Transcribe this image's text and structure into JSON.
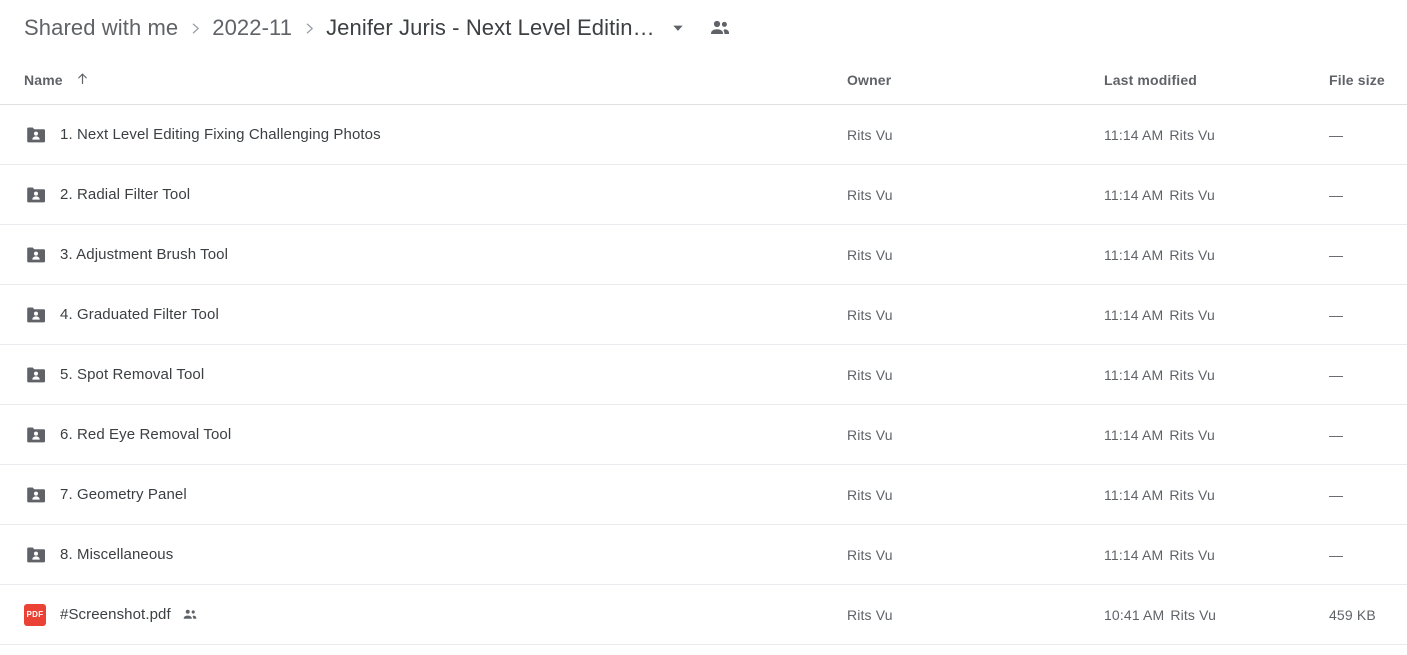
{
  "breadcrumb": {
    "items": [
      {
        "label": "Shared with me",
        "active": false
      },
      {
        "label": "2022-11",
        "active": false
      },
      {
        "label": "Jenifer Juris - Next Level Editin…",
        "active": true
      }
    ],
    "caret_icon": "chevron-down-icon",
    "share_icon": "people-shared-icon",
    "separator_icon": "chevron-right-icon"
  },
  "table": {
    "columns": {
      "name": "Name",
      "owner": "Owner",
      "last_modified": "Last modified",
      "file_size": "File size"
    },
    "sort": {
      "column": "Name",
      "direction": "ascending",
      "icon": "arrow-up-icon"
    },
    "rows": [
      {
        "icon": "shared-folder-icon",
        "type": "folder",
        "name": "1. Next Level Editing Fixing Challenging Photos",
        "shared": false,
        "owner": "Rits Vu",
        "modified_time": "11:14 AM",
        "modified_by": "Rits Vu",
        "size": "—"
      },
      {
        "icon": "shared-folder-icon",
        "type": "folder",
        "name": "2. Radial Filter Tool",
        "shared": false,
        "owner": "Rits Vu",
        "modified_time": "11:14 AM",
        "modified_by": "Rits Vu",
        "size": "—"
      },
      {
        "icon": "shared-folder-icon",
        "type": "folder",
        "name": "3. Adjustment Brush Tool",
        "shared": false,
        "owner": "Rits Vu",
        "modified_time": "11:14 AM",
        "modified_by": "Rits Vu",
        "size": "—"
      },
      {
        "icon": "shared-folder-icon",
        "type": "folder",
        "name": "4. Graduated Filter Tool",
        "shared": false,
        "owner": "Rits Vu",
        "modified_time": "11:14 AM",
        "modified_by": "Rits Vu",
        "size": "—"
      },
      {
        "icon": "shared-folder-icon",
        "type": "folder",
        "name": "5. Spot Removal Tool",
        "shared": false,
        "owner": "Rits Vu",
        "modified_time": "11:14 AM",
        "modified_by": "Rits Vu",
        "size": "—"
      },
      {
        "icon": "shared-folder-icon",
        "type": "folder",
        "name": "6. Red Eye Removal Tool",
        "shared": false,
        "owner": "Rits Vu",
        "modified_time": "11:14 AM",
        "modified_by": "Rits Vu",
        "size": "—"
      },
      {
        "icon": "shared-folder-icon",
        "type": "folder",
        "name": "7. Geometry Panel",
        "shared": false,
        "owner": "Rits Vu",
        "modified_time": "11:14 AM",
        "modified_by": "Rits Vu",
        "size": "—"
      },
      {
        "icon": "shared-folder-icon",
        "type": "folder",
        "name": "8. Miscellaneous",
        "shared": false,
        "owner": "Rits Vu",
        "modified_time": "11:14 AM",
        "modified_by": "Rits Vu",
        "size": "—"
      },
      {
        "icon": "pdf-file-icon",
        "type": "pdf",
        "icon_label": "PDF",
        "name": "#Screenshot.pdf",
        "shared": true,
        "owner": "Rits Vu",
        "modified_time": "10:41 AM",
        "modified_by": "Rits Vu",
        "size": "459 KB"
      }
    ]
  },
  "colors": {
    "folder_icon": "#5f6368",
    "pdf_icon": "#ea4335",
    "text_primary": "#3c4043",
    "text_secondary": "#5f6368",
    "divider": "#e8eaed"
  }
}
